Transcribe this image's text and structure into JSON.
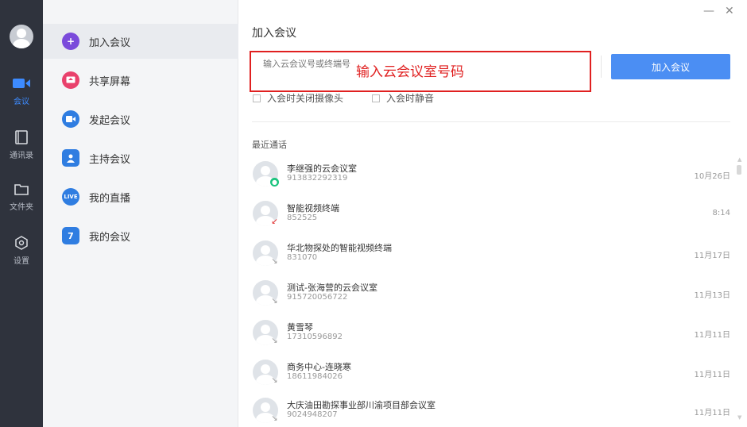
{
  "rail": {
    "items": [
      {
        "label": "会议",
        "icon": "camera-icon"
      },
      {
        "label": "通讯录",
        "icon": "contacts-icon"
      },
      {
        "label": "文件夹",
        "icon": "folder-icon"
      },
      {
        "label": "设置",
        "icon": "settings-icon"
      }
    ]
  },
  "menu": {
    "items": [
      {
        "label": "加入会议",
        "icon": "plus-icon",
        "color": "#7b4bdb"
      },
      {
        "label": "共享屏幕",
        "icon": "share-screen-icon",
        "color": "#e9416c"
      },
      {
        "label": "发起会议",
        "icon": "video-icon",
        "color": "#2f7de1"
      },
      {
        "label": "主持会议",
        "icon": "host-icon",
        "color": "#2f7de1"
      },
      {
        "label": "我的直播",
        "icon": "live-icon",
        "color": "#2f7de1",
        "icon_text": "LIVE"
      },
      {
        "label": "我的会议",
        "icon": "calendar-icon",
        "color": "#2f7de1",
        "icon_text": "7"
      }
    ]
  },
  "main": {
    "window_controls": {
      "minimize": "—",
      "close": "✕"
    },
    "title": "加入会议",
    "input_placeholder": "输入云会议号或终端号",
    "overlay_text": "输入云会议室号码",
    "join_button": "加入会议",
    "options": [
      "入会时关闭摄像头",
      "入会时静音"
    ],
    "recent_title": "最近通话",
    "calls": [
      {
        "name": "李继强的云会议室",
        "number": "913832292319",
        "time": "10月26日",
        "badge": "green"
      },
      {
        "name": "智能视频终端",
        "number": "852525",
        "time": "8:14",
        "badge": "red"
      },
      {
        "name": "华北物探处的智能视频终端",
        "number": "831070",
        "time": "11月17日",
        "badge": "gray"
      },
      {
        "name": "测试-张海营的云会议室",
        "number": "915720056722",
        "time": "11月13日",
        "badge": "gray"
      },
      {
        "name": "黄雪琴",
        "number": "17310596892",
        "time": "11月11日",
        "badge": "gray"
      },
      {
        "name": "商务中心-连晓寒",
        "number": "18611984026",
        "time": "11月11日",
        "badge": "gray"
      },
      {
        "name": "大庆油田勘探事业部川渝项目部会议室",
        "number": "9024948207",
        "time": "11月11日",
        "badge": "gray"
      }
    ]
  },
  "colors": {
    "accent": "#4b8ef3",
    "annotation": "#e02020",
    "rail": "#2f333d"
  }
}
